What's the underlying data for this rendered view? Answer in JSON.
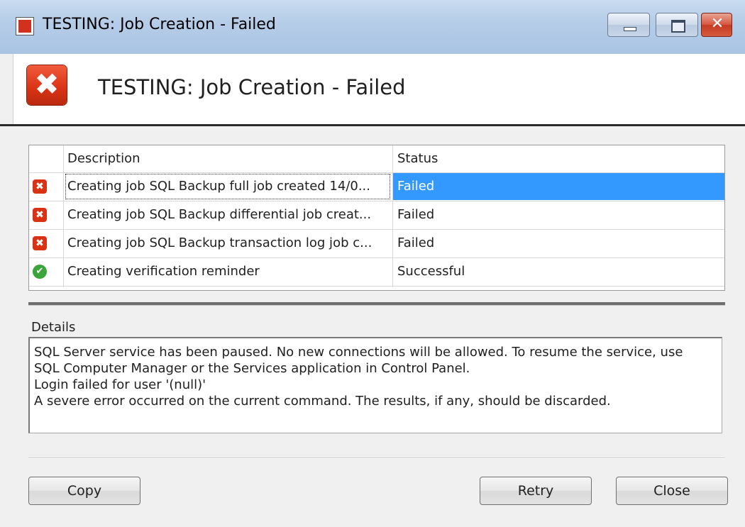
{
  "window": {
    "title": "TESTING: Job Creation - Failed",
    "close_glyph": "✕"
  },
  "header": {
    "heading": "TESTING: Job Creation - Failed",
    "error_glyph": "✖"
  },
  "list": {
    "columns": [
      "Description",
      "Status"
    ],
    "rows": [
      {
        "icon": "error-icon",
        "description": "Creating job SQL Backup full job created 14/0...",
        "status": "Failed",
        "selected": true
      },
      {
        "icon": "error-icon",
        "description": "Creating job SQL Backup differential job creat...",
        "status": "Failed",
        "selected": false
      },
      {
        "icon": "error-icon",
        "description": "Creating job SQL Backup transaction log job c...",
        "status": "Failed",
        "selected": false
      },
      {
        "icon": "success-icon",
        "description": "Creating verification reminder",
        "status": "Successful",
        "selected": false
      }
    ]
  },
  "details": {
    "label": "Details",
    "lines": [
      "SQL Server service has been paused. No new connections will be allowed. To resume the service, use",
      "SQL Computer Manager or the Services application in Control Panel.",
      "Login failed for user '(null)'",
      "A severe error occurred on the current command.  The results, if any, should be discarded."
    ]
  },
  "buttons": {
    "copy": "Copy",
    "retry": "Retry",
    "close": "Close"
  },
  "colors": {
    "selection": "#3399ff",
    "error": "#d93214",
    "success": "#3aa53a"
  }
}
